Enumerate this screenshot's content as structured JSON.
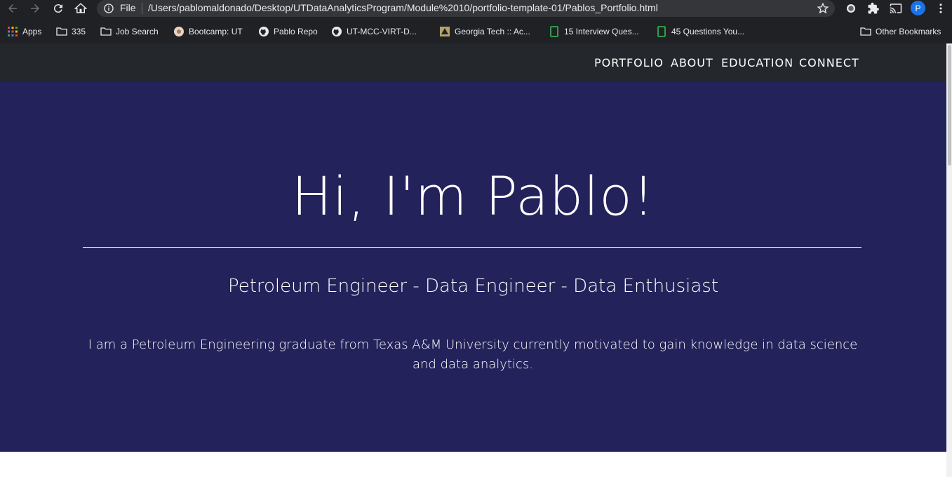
{
  "browser": {
    "file_label": "File",
    "url": "/Users/pablomaldonado/Desktop/UTDataAnalyticsProgram/Module%2010/portfolio-template-01/Pablos_Portfolio.html",
    "profile_initial": "P",
    "bookmarks": [
      {
        "icon": "apps-grid-icon",
        "label": "Apps"
      },
      {
        "icon": "folder-icon",
        "label": "335"
      },
      {
        "icon": "folder-icon",
        "label": "Job Search"
      },
      {
        "icon": "bootcamp-icon",
        "label": "Bootcamp: UT"
      },
      {
        "icon": "github-icon",
        "label": "Pablo Repo"
      },
      {
        "icon": "github-icon",
        "label": "UT-MCC-VIRT-D..."
      },
      {
        "icon": "georgia-tech-icon",
        "label": "Georgia Tech :: Ac..."
      },
      {
        "icon": "sheet-icon",
        "label": "15 Interview Ques..."
      },
      {
        "icon": "sheet-icon",
        "label": "45 Questions You..."
      },
      {
        "icon": "folder-icon",
        "label": "Other Bookmarks"
      }
    ]
  },
  "nav": {
    "links": [
      "PORTFOLIO",
      "ABOUT",
      "EDUCATION",
      "CONNECT"
    ]
  },
  "hero": {
    "title": "Hi, I'm Pablo!",
    "subtitle": "Petroleum Engineer - Data Engineer - Data Enthusiast",
    "description": "I am a Petroleum Engineering graduate from Texas A&M University currently motivated to gain knowledge in data science and data analytics."
  },
  "colors": {
    "chrome": "#202124",
    "omnibox": "#35363a",
    "nav_bg": "#24272b",
    "hero_bg": "#24225a",
    "text_light": "#ffffff"
  }
}
